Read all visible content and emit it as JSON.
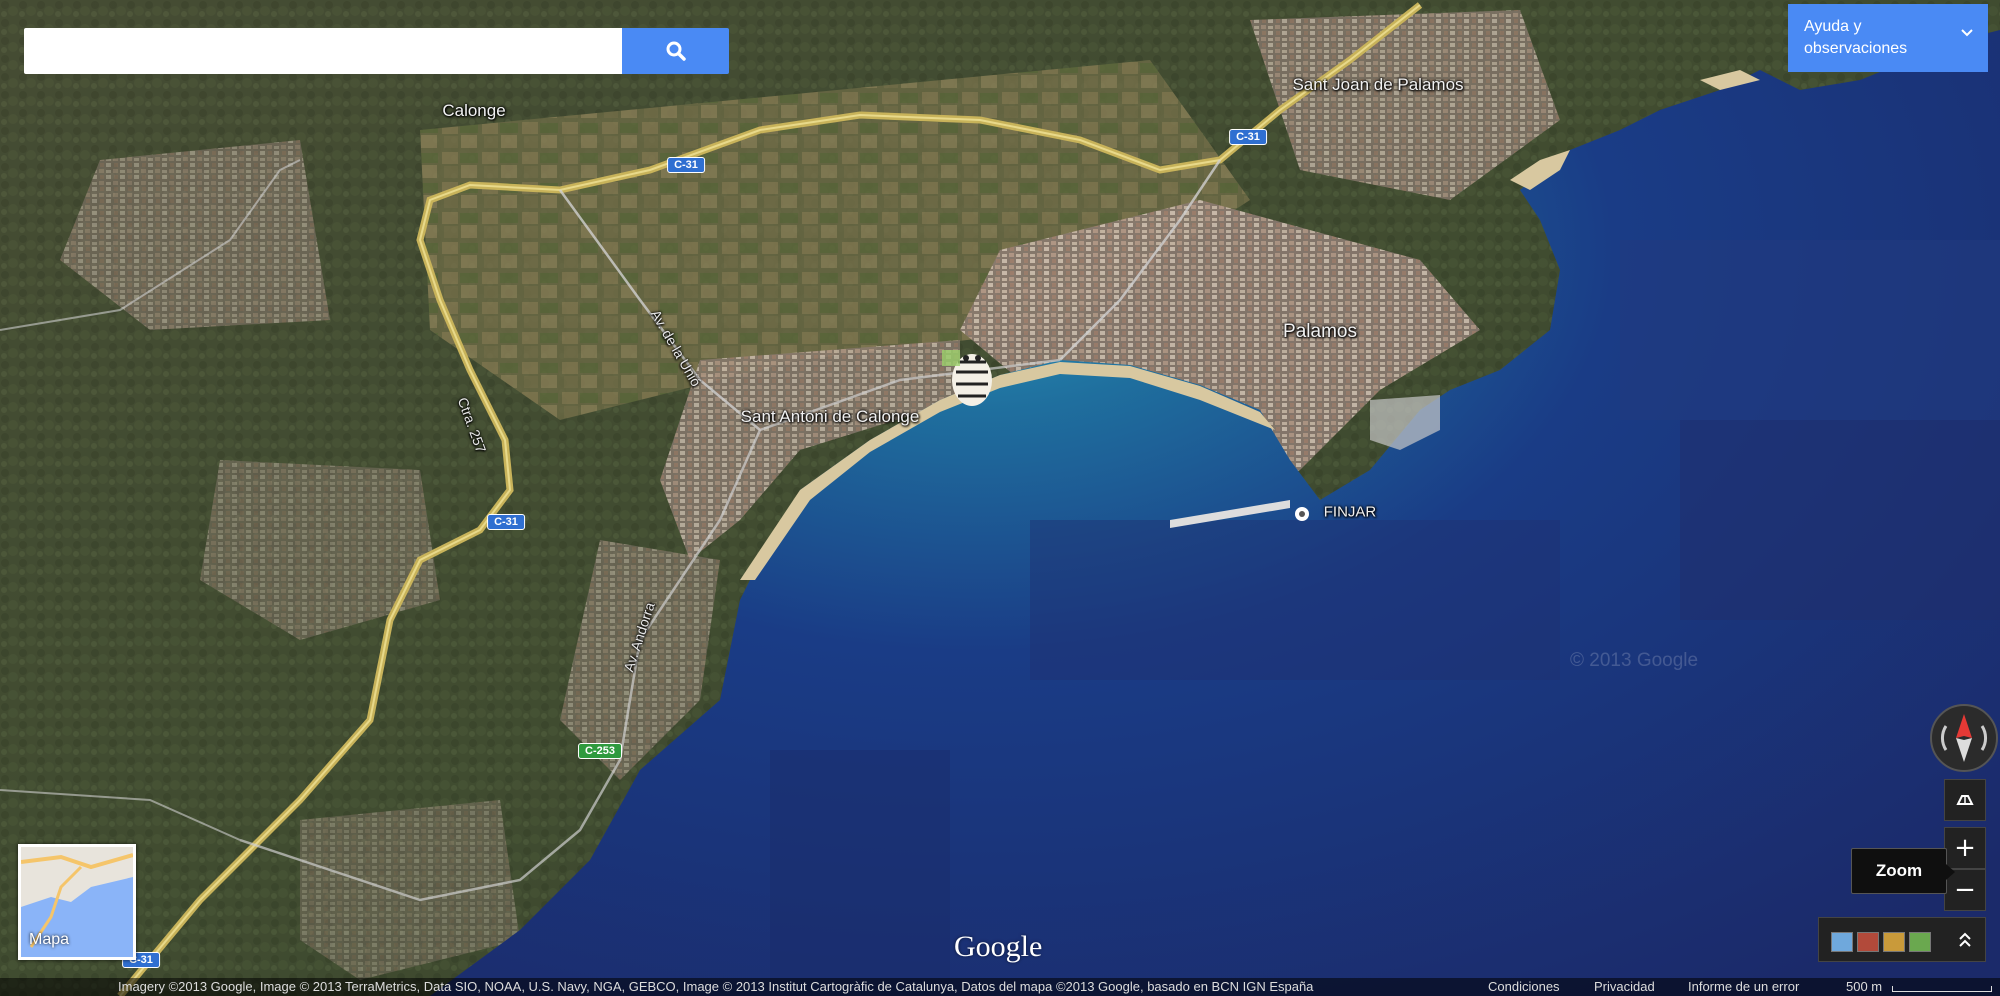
{
  "search": {
    "placeholder": "",
    "value": "",
    "button_icon": "search-icon"
  },
  "help": {
    "label_line1": "Ayuda y",
    "label_line2": "observaciones",
    "icon": "chevron-down-icon"
  },
  "map_labels": {
    "towns": {
      "calonge": "Calonge",
      "sant_joan": "Sant Joan de Palamos",
      "palamos": "Palamos",
      "sant_antoni": "Sant Antoni de Calonge"
    },
    "roads": {
      "av_unio": "Av. de la Unió",
      "ctra_257": "Ctra. 257",
      "av_andorra": "Av. Andorra"
    },
    "shields": {
      "c31": "C-31",
      "c253": "C-253"
    },
    "poi": {
      "finjar": "FINJAR"
    },
    "watermark": "© 2013 Google"
  },
  "controls": {
    "compass_icon": "compass-icon",
    "tilt_icon": "tilt-icon",
    "zoom_in": "+",
    "zoom_out": "−",
    "zoom_tooltip": "Zoom",
    "expand_icon": "chevron-up-icon"
  },
  "minimap": {
    "label": "Mapa"
  },
  "logo": {
    "text": "Google"
  },
  "footer": {
    "attribution": "Imagery ©2013 Google, Image © 2013 TerraMetrics, Data SIO, NOAA, U.S. Navy, NGA, GEBCO, Image © 2013 Institut Cartogràfic de Catalunya, Datos del mapa ©2013 Google, basado en BCN IGN España",
    "condiciones": "Condiciones",
    "privacidad": "Privacidad",
    "informe": "Informe de un error",
    "scale": "500 m"
  },
  "colors": {
    "accent": "#4a8af4",
    "road_highway": "#c8b35a",
    "sea_deep": "#1e2f6e",
    "sea_shallow": "#2a8fb0"
  }
}
